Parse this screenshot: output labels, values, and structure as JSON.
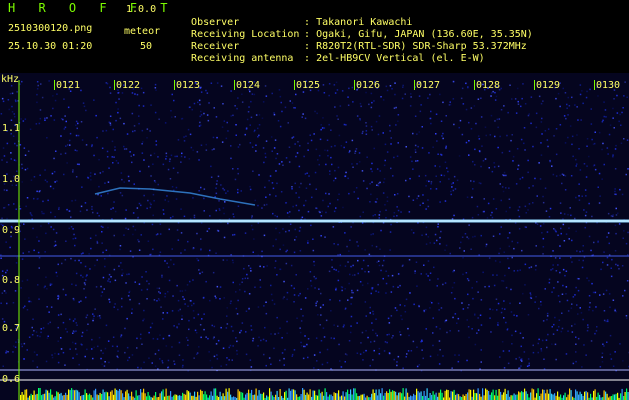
{
  "header": {
    "title": "H R O F F T",
    "version": "1.0.0",
    "filename": "2510300120.png",
    "mode": "meteor",
    "datetime": "25.10.30 01:20",
    "count": "50"
  },
  "info": [
    {
      "label": "Observer",
      "value": ": Takanori Kawachi"
    },
    {
      "label": "Receiving Location",
      "value": ": Ogaki, Gifu, JAPAN (136.60E, 35.35N)"
    },
    {
      "label": "Receiver",
      "value": ": R820T2(RTL-SDR) SDR-Sharp 53.372MHz"
    },
    {
      "label": "Receiving antenna",
      "value": ": 2el-HB9CV Vertical (el. E-W)"
    }
  ],
  "spectrogram": {
    "y_unit": "kHz",
    "y_ticks": [
      "1.1",
      "1.0",
      "0.9",
      "0.8",
      "0.7",
      "0.6"
    ],
    "x_ticks": [
      "0121",
      "0122",
      "0123",
      "0124",
      "0125",
      "0126",
      "0127",
      "0128",
      "0129",
      "0130"
    ],
    "colors": {
      "background": "#05051f",
      "noise": "#1a2bd0",
      "carrier": "#8fd8ff",
      "axis": "#7CFC00",
      "label": "#ffff66"
    }
  }
}
